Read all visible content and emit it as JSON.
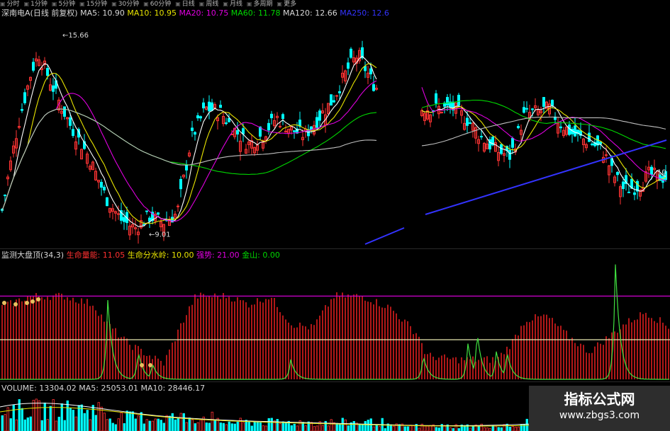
{
  "toolbar": {
    "items": [
      "分时",
      "1分钟",
      "5分钟",
      "15分钟",
      "30分钟",
      "60分钟",
      "日线",
      "周线",
      "月线",
      "多周期",
      "更多"
    ]
  },
  "main_header": {
    "stock": "深南电A(日线 前复权)",
    "ma5": "MA5: 10.90",
    "ma10": "MA10: 10.95",
    "ma20": "MA20: 10.75",
    "ma60": "MA60: 11.78",
    "ma120": "MA120: 12.66",
    "ma250": "MA250: 12.6"
  },
  "indicator_header": {
    "name": "监测大盘顶(34,3)",
    "life_quantity": "生命量能: 11.05",
    "watershed": "生命分水岭: 10.00",
    "momentum": "强势: 21.00",
    "golden": "金山: 0.00"
  },
  "volume_header": {
    "volume": "VOLUME: 13304.02",
    "ma5": "MA5: 25053.01",
    "ma10": "MA10: 28446.17"
  },
  "annotations": {
    "high": "15.66",
    "low": "9.01",
    "right": "10"
  },
  "watermark": {
    "title": "指标公式网",
    "url": "www.zbgs3.com"
  },
  "colors": {
    "up": "#ff3333",
    "down": "#00ffff",
    "ma5": "#ffffff",
    "ma10": "#e8e400",
    "ma20": "#e000e0",
    "ma60": "#00d800",
    "ma120": "#c0c0c0",
    "ma250": "#3333ff",
    "bars": "#b01818",
    "upper_line": "#d000d0",
    "lower_line": "#e8e8b0",
    "spike": "#40e040"
  },
  "chart_data": [
    {
      "type": "candlestick",
      "title": "深南电A(日线 前复权)",
      "price_range": [
        8.6,
        16.2
      ],
      "high_label": 15.66,
      "low_label": 9.01,
      "close_anchors": [
        [
          0,
          9.4
        ],
        [
          12,
          11.0
        ],
        [
          25,
          12.6
        ],
        [
          45,
          14.5
        ],
        [
          55,
          15.0
        ],
        [
          80,
          13.6
        ],
        [
          100,
          12.6
        ],
        [
          125,
          11.6
        ],
        [
          150,
          10.2
        ],
        [
          170,
          9.5
        ],
        [
          190,
          9.2
        ],
        [
          210,
          9.6
        ],
        [
          230,
          9.4
        ],
        [
          250,
          9.7
        ],
        [
          270,
          12.2
        ],
        [
          290,
          13.2
        ],
        [
          310,
          13.1
        ],
        [
          330,
          12.5
        ],
        [
          350,
          12.0
        ],
        [
          370,
          12.3
        ],
        [
          390,
          12.9
        ],
        [
          410,
          12.5
        ],
        [
          430,
          12.3
        ],
        [
          450,
          12.9
        ],
        [
          470,
          13.5
        ],
        [
          490,
          14.5
        ],
        [
          505,
          15.0
        ],
        [
          520,
          14.3
        ],
        [
          530,
          13.9
        ],
        [
          595,
          13.2
        ],
        [
          640,
          13.2
        ],
        [
          660,
          12.8
        ],
        [
          680,
          12.2
        ],
        [
          700,
          11.8
        ],
        [
          720,
          11.6
        ],
        [
          740,
          13.0
        ],
        [
          760,
          13.1
        ],
        [
          775,
          13.2
        ],
        [
          790,
          12.7
        ],
        [
          810,
          12.3
        ],
        [
          830,
          12.1
        ],
        [
          850,
          11.8
        ],
        [
          865,
          11.0
        ],
        [
          880,
          10.5
        ],
        [
          900,
          10.6
        ],
        [
          915,
          11.0
        ],
        [
          935,
          10.9
        ]
      ]
    },
    {
      "type": "bar",
      "title": "监测大盘顶(34,3)",
      "upper_level": 21.0,
      "lower_level": 10.0,
      "range": [
        0,
        30
      ],
      "bar_anchors": [
        [
          0,
          18
        ],
        [
          40,
          21
        ],
        [
          90,
          21
        ],
        [
          130,
          19
        ],
        [
          150,
          14
        ],
        [
          180,
          9
        ],
        [
          230,
          4
        ],
        [
          255,
          14
        ],
        [
          275,
          21
        ],
        [
          320,
          21
        ],
        [
          350,
          19
        ],
        [
          380,
          21
        ],
        [
          410,
          14
        ],
        [
          440,
          13
        ],
        [
          470,
          21
        ],
        [
          510,
          21
        ],
        [
          550,
          18
        ],
        [
          590,
          11
        ],
        [
          600,
          6
        ],
        [
          640,
          5
        ],
        [
          700,
          5
        ],
        [
          720,
          9
        ],
        [
          740,
          15
        ],
        [
          770,
          16
        ],
        [
          800,
          11
        ],
        [
          830,
          7
        ],
        [
          860,
          11
        ],
        [
          880,
          14
        ],
        [
          910,
          17
        ],
        [
          945,
          13
        ]
      ],
      "spikes": [
        [
          152,
          20
        ],
        [
          195,
          7
        ],
        [
          215,
          4
        ],
        [
          410,
          5
        ],
        [
          597,
          6
        ],
        [
          660,
          9
        ],
        [
          673,
          12
        ],
        [
          700,
          7
        ],
        [
          715,
          7
        ],
        [
          868,
          29
        ]
      ]
    },
    {
      "type": "bar",
      "title": "VOLUME",
      "volume_level": 13304.02,
      "ma5": 25053.01,
      "ma10": 28446.17
    }
  ]
}
